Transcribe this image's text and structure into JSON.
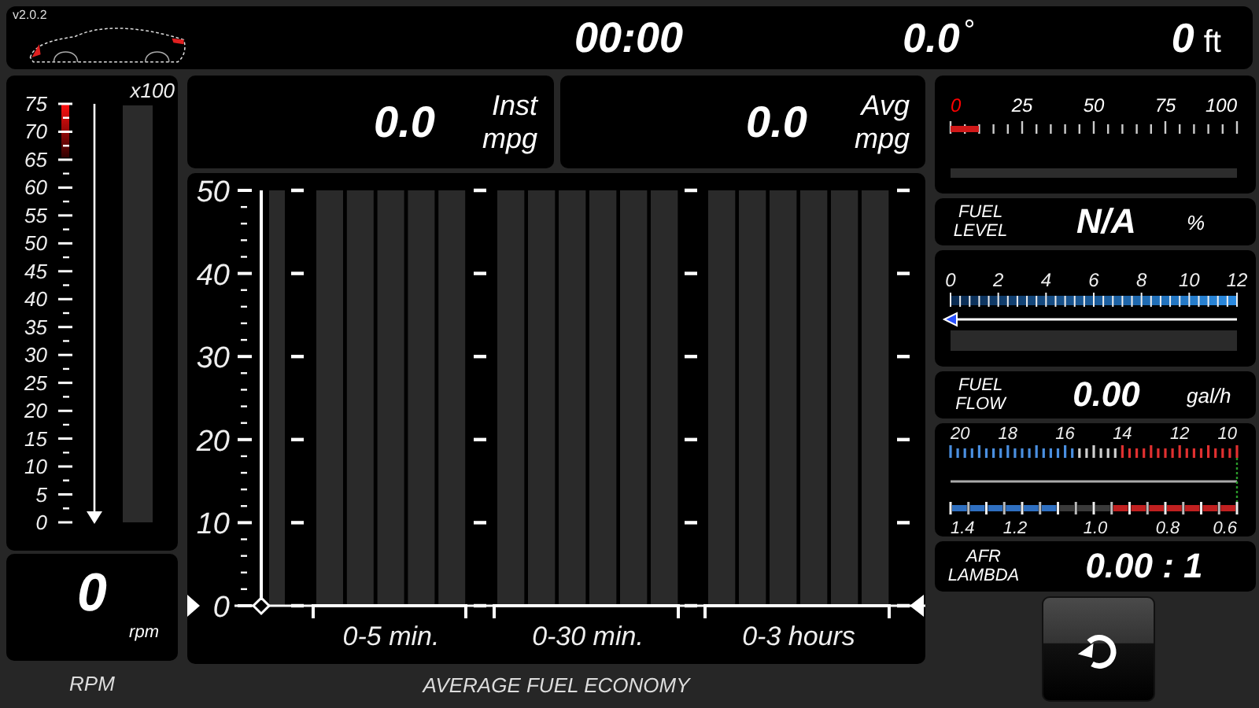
{
  "top_bar": {
    "version": "v2.0.2",
    "timer": "00:00",
    "temperature": {
      "value": "0.0",
      "unit": "°"
    },
    "altitude": {
      "value": "0",
      "unit": "ft"
    }
  },
  "rpm": {
    "multiplier": "x100",
    "scale": [
      "75",
      "70",
      "65",
      "60",
      "55",
      "50",
      "45",
      "40",
      "35",
      "30",
      "25",
      "20",
      "15",
      "10",
      "5",
      "0"
    ],
    "value": "0",
    "unit": "rpm",
    "label": "RPM"
  },
  "mpg_readouts": [
    {
      "value": "0.0",
      "label": "Inst mpg"
    },
    {
      "value": "0.0",
      "label": "Avg mpg"
    }
  ],
  "economy_chart": {
    "y_ticks": [
      "50",
      "40",
      "30",
      "20",
      "10",
      "0"
    ],
    "groups": [
      {
        "label": "0-5 min."
      },
      {
        "label": "0-30 min."
      },
      {
        "label": "0-3 hours"
      }
    ],
    "title": "AVERAGE FUEL ECONOMY"
  },
  "fuel_level": {
    "scale": [
      {
        "label": "0",
        "color": "#ff0000"
      },
      {
        "label": "25",
        "color": "#ffffff"
      },
      {
        "label": "50",
        "color": "#ffffff"
      },
      {
        "label": "75",
        "color": "#ffffff"
      },
      {
        "label": "100",
        "color": "#ffffff"
      }
    ],
    "label": "FUEL LEVEL",
    "value": "N/A",
    "unit": "%"
  },
  "fuel_flow": {
    "scale": [
      "0",
      "2",
      "4",
      "6",
      "8",
      "10",
      "12"
    ],
    "level": 0,
    "label": "FUEL FLOW",
    "value": "0.00",
    "unit": "gal/h"
  },
  "afr": {
    "afr_scale": [
      "20",
      "18",
      "16",
      "14",
      "12",
      "10"
    ],
    "lambda_scale": [
      "1.4",
      "1.2",
      "1.0",
      "0.8",
      "0.6"
    ],
    "label": "AFR LAMBDA",
    "value": "0.00 : 1"
  }
}
